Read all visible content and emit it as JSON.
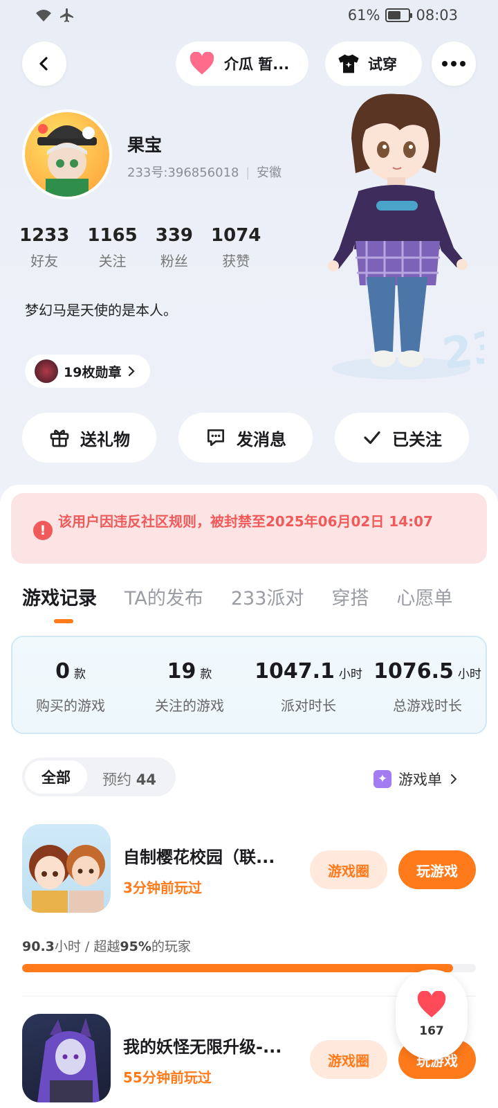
{
  "status_bar": {
    "battery": "61%",
    "time": "08:03",
    "battery_level": 0.61
  },
  "header": {
    "relationship_label": "介瓜 暂...",
    "try_on_label": "试穿"
  },
  "profile": {
    "name": "果宝",
    "uid": "233号:396856018",
    "region": "安徽",
    "stats": [
      {
        "value": "1233",
        "label": "好友"
      },
      {
        "value": "1165",
        "label": "关注"
      },
      {
        "value": "339",
        "label": "粉丝"
      },
      {
        "value": "1074",
        "label": "获赞"
      }
    ],
    "bio": "梦幻马是天使的是本人。",
    "badges_label": "19枚勋章"
  },
  "actions": {
    "gift": "送礼物",
    "message": "发消息",
    "followed": "已关注"
  },
  "ban_notice": {
    "icon_text": "!",
    "text": "该用户因违反社区规则，被封禁至2025年06月02日 14:07"
  },
  "tabs": [
    "游戏记录",
    "TA的发布",
    "233派对",
    "穿搭",
    "心愿单"
  ],
  "summary": [
    {
      "value": "0",
      "unit": "款",
      "label": "购买的游戏"
    },
    {
      "value": "19",
      "unit": "款",
      "label": "关注的游戏"
    },
    {
      "value": "1047.1",
      "unit": "小时",
      "label": "派对时长"
    },
    {
      "value": "1076.5",
      "unit": "小时",
      "label": "总游戏时长"
    }
  ],
  "filters": {
    "all": "全部",
    "reserve": "预约",
    "reserve_count": "44",
    "game_list": "游戏单"
  },
  "games": [
    {
      "title": "自制樱花校园（联...",
      "last_played": "3分钟前玩过",
      "circle_label": "游戏圈",
      "play_label": "玩游戏",
      "hours": "90.3",
      "hours_unit": "小时 / 超越",
      "percent": "95%",
      "percent_suffix": "的玩家",
      "progress": 0.95
    },
    {
      "title": "我的妖怪无限升级-...",
      "last_played": "55分钟前玩过",
      "circle_label": "游戏圈",
      "play_label": "玩游戏"
    }
  ],
  "like_float": {
    "count": "167"
  },
  "colors": {
    "accent": "#ff7a1a",
    "ban_red": "#f05a5a",
    "ban_bg": "#fde4e4"
  }
}
